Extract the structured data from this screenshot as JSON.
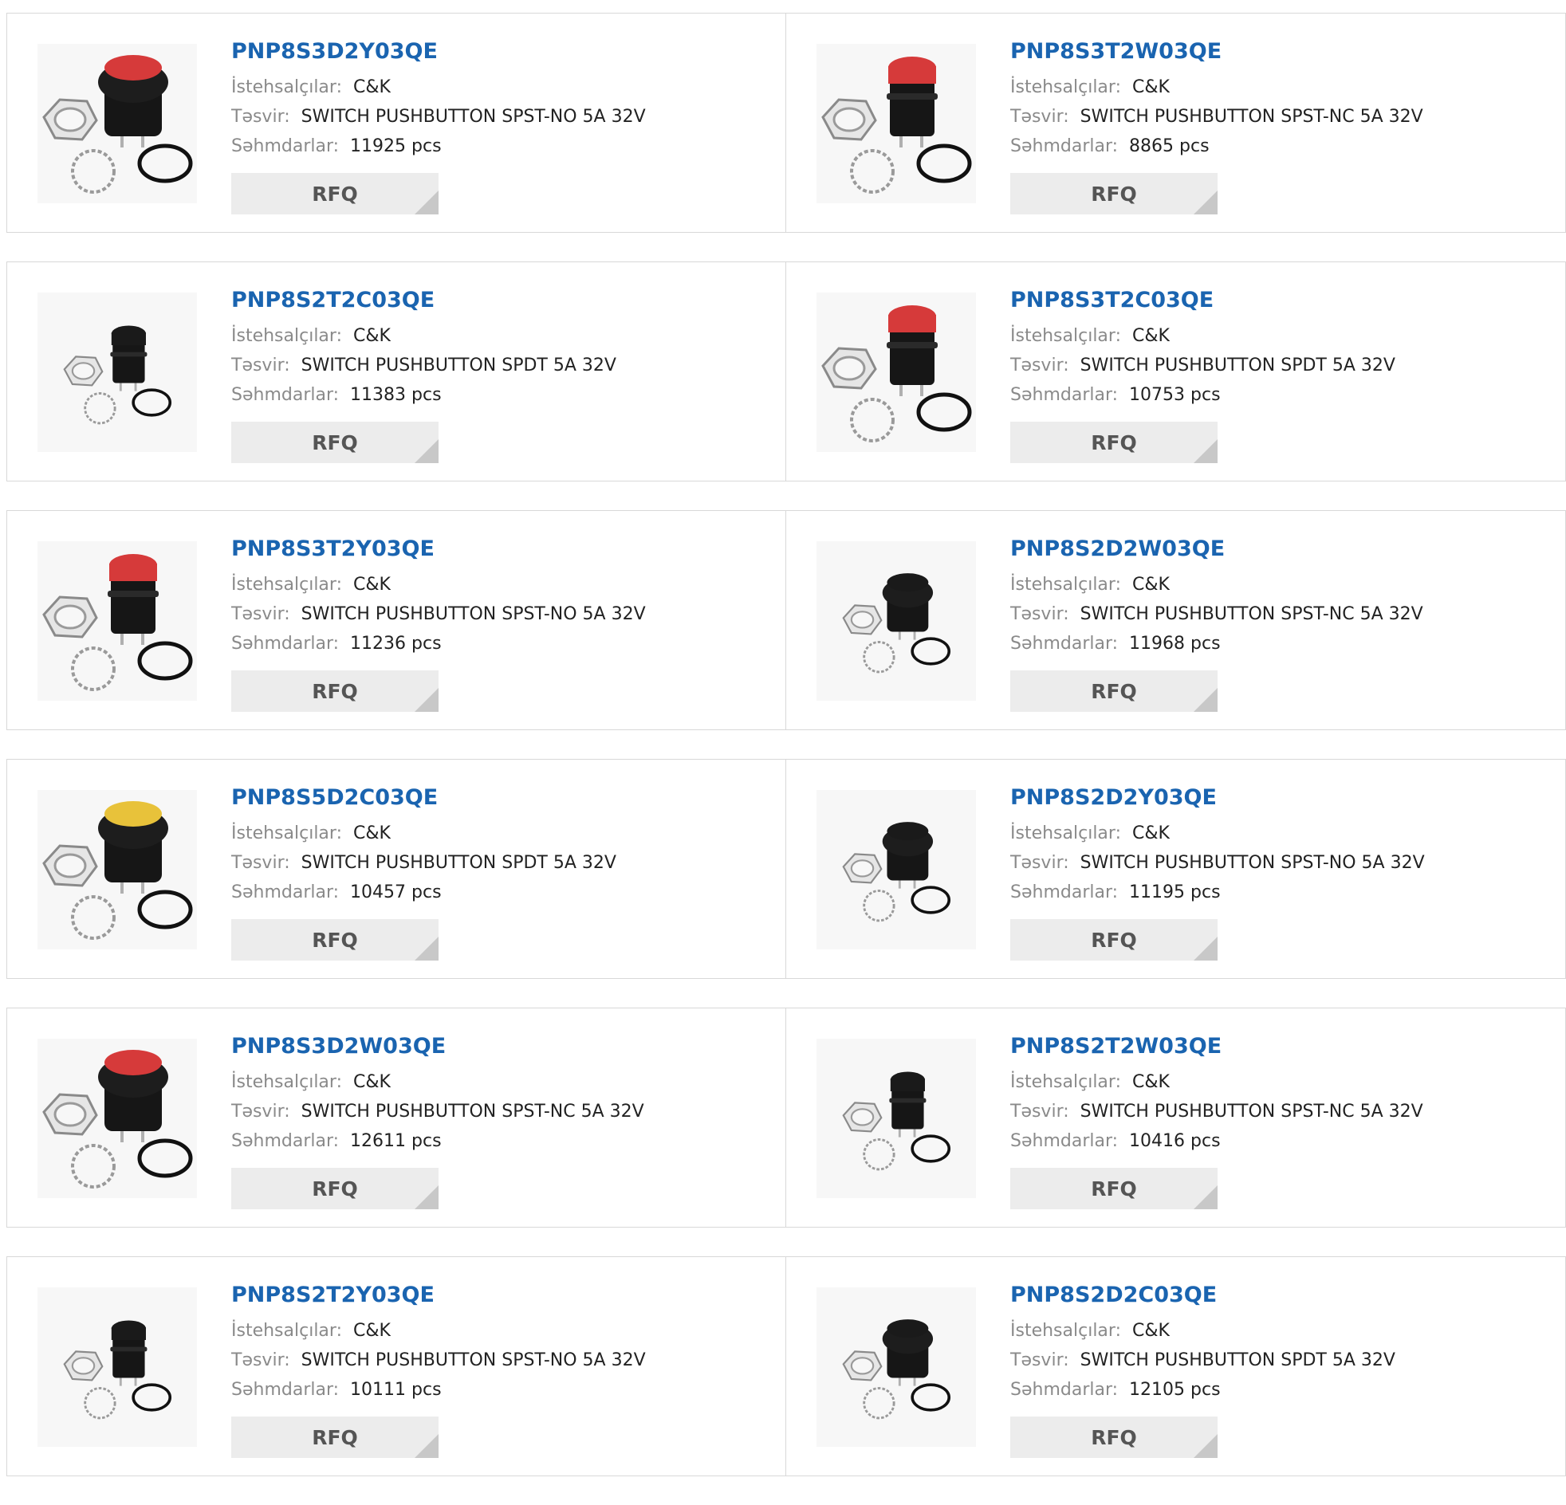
{
  "labels": {
    "manufacturer": "İstehsalçılar:",
    "description": "Təsvir:",
    "stock": "Səhmdarlar:",
    "rfq": "RFQ"
  },
  "products": [
    {
      "part": "PNP8S3D2Y03QE",
      "manufacturer": "C&K",
      "description": "SWITCH PUSHBUTTON SPST-NO 5A 32V",
      "stock": "11925 pcs",
      "cap_color": "#d63a3a",
      "style": "dome"
    },
    {
      "part": "PNP8S3T2W03QE",
      "manufacturer": "C&K",
      "description": "SWITCH PUSHBUTTON SPST-NC 5A 32V",
      "stock": "8865 pcs",
      "cap_color": "#d63a3a",
      "style": "tall"
    },
    {
      "part": "PNP8S2T2C03QE",
      "manufacturer": "C&K",
      "description": "SWITCH PUSHBUTTON SPDT 5A 32V",
      "stock": "11383 pcs",
      "cap_color": "#1a1a1a",
      "style": "tall-small"
    },
    {
      "part": "PNP8S3T2C03QE",
      "manufacturer": "C&K",
      "description": "SWITCH PUSHBUTTON SPDT 5A 32V",
      "stock": "10753 pcs",
      "cap_color": "#d63a3a",
      "style": "tall"
    },
    {
      "part": "PNP8S3T2Y03QE",
      "manufacturer": "C&K",
      "description": "SWITCH PUSHBUTTON SPST-NO 5A 32V",
      "stock": "11236 pcs",
      "cap_color": "#d63a3a",
      "style": "tall"
    },
    {
      "part": "PNP8S2D2W03QE",
      "manufacturer": "C&K",
      "description": "SWITCH PUSHBUTTON SPST-NC 5A 32V",
      "stock": "11968 pcs",
      "cap_color": "#1a1a1a",
      "style": "dome-small"
    },
    {
      "part": "PNP8S5D2C03QE",
      "manufacturer": "C&K",
      "description": "SWITCH PUSHBUTTON SPDT 5A 32V",
      "stock": "10457 pcs",
      "cap_color": "#e8c23a",
      "style": "dome"
    },
    {
      "part": "PNP8S2D2Y03QE",
      "manufacturer": "C&K",
      "description": "SWITCH PUSHBUTTON SPST-NO 5A 32V",
      "stock": "11195 pcs",
      "cap_color": "#1a1a1a",
      "style": "dome-small"
    },
    {
      "part": "PNP8S3D2W03QE",
      "manufacturer": "C&K",
      "description": "SWITCH PUSHBUTTON SPST-NC 5A 32V",
      "stock": "12611 pcs",
      "cap_color": "#d63a3a",
      "style": "dome"
    },
    {
      "part": "PNP8S2T2W03QE",
      "manufacturer": "C&K",
      "description": "SWITCH PUSHBUTTON SPST-NC 5A 32V",
      "stock": "10416 pcs",
      "cap_color": "#1a1a1a",
      "style": "tall-small"
    },
    {
      "part": "PNP8S2T2Y03QE",
      "manufacturer": "C&K",
      "description": "SWITCH PUSHBUTTON SPST-NO 5A 32V",
      "stock": "10111 pcs",
      "cap_color": "#1a1a1a",
      "style": "tall-small"
    },
    {
      "part": "PNP8S2D2C03QE",
      "manufacturer": "C&K",
      "description": "SWITCH PUSHBUTTON SPDT 5A 32V",
      "stock": "12105 pcs",
      "cap_color": "#1a1a1a",
      "style": "dome-small"
    }
  ]
}
